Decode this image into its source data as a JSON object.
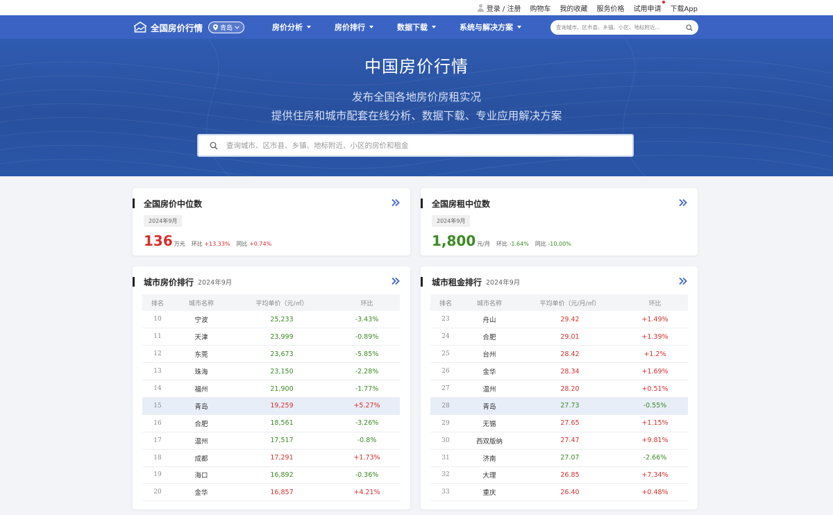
{
  "topbar": {
    "login": "登录 / 注册",
    "cart": "购物车",
    "favorites": "我的收藏",
    "service_price": "服务价格",
    "trial": "试用申请",
    "download_app": "下载App"
  },
  "nav": {
    "logo_text": "全国房价行情",
    "city": "青岛",
    "menu": [
      "房价分析",
      "房价排行",
      "数据下载",
      "系统与解决方案"
    ],
    "search_placeholder": "查询城市、区市县、乡镇、小区、地标附近..."
  },
  "hero": {
    "title": "中国房价行情",
    "subtitle1": "发布全国各地房价房租实况",
    "subtitle2": "提供住房和城市配套在线分析、数据下载、专业应用解决方案",
    "search_placeholder": "查询城市、区市县、乡镇、地标附近、小区的房价和租金"
  },
  "price_median": {
    "title": "全国房价中位数",
    "date": "2024年9月",
    "value": "136",
    "unit": "万元",
    "mom_label": "环比",
    "mom": "+13.33%",
    "yoy_label": "同比",
    "yoy": "+0.74%"
  },
  "rent_median": {
    "title": "全国房租中位数",
    "date": "2024年9月",
    "value": "1,800",
    "unit": "元/月",
    "mom_label": "环比",
    "mom": "-1.64%",
    "yoy_label": "同比",
    "yoy": "-10.00%"
  },
  "price_rank": {
    "title": "城市房价排行",
    "date": "2024年9月",
    "headers": [
      "排名",
      "城市名称",
      "平均单价（元/㎡）",
      "环比"
    ],
    "rows": [
      {
        "rank": "10",
        "city": "宁波",
        "price": "25,233",
        "chg": "-3.43%",
        "dir": "down"
      },
      {
        "rank": "11",
        "city": "天津",
        "price": "23,999",
        "chg": "-0.89%",
        "dir": "down"
      },
      {
        "rank": "12",
        "city": "东莞",
        "price": "23,673",
        "chg": "-5.85%",
        "dir": "down"
      },
      {
        "rank": "13",
        "city": "珠海",
        "price": "23,150",
        "chg": "-2.28%",
        "dir": "down"
      },
      {
        "rank": "14",
        "city": "福州",
        "price": "21,900",
        "chg": "-1.77%",
        "dir": "down"
      },
      {
        "rank": "15",
        "city": "青岛",
        "price": "19,259",
        "chg": "+5.27%",
        "dir": "up",
        "highlight": true
      },
      {
        "rank": "16",
        "city": "合肥",
        "price": "18,561",
        "chg": "-3.26%",
        "dir": "down"
      },
      {
        "rank": "17",
        "city": "温州",
        "price": "17,517",
        "chg": "-0.8%",
        "dir": "down"
      },
      {
        "rank": "18",
        "city": "成都",
        "price": "17,291",
        "chg": "+1.73%",
        "dir": "up"
      },
      {
        "rank": "19",
        "city": "海口",
        "price": "16,892",
        "chg": "-0.36%",
        "dir": "down"
      },
      {
        "rank": "20",
        "city": "金华",
        "price": "16,857",
        "chg": "+4.21%",
        "dir": "up"
      }
    ]
  },
  "rent_rank": {
    "title": "城市租金排行",
    "date": "2024年9月",
    "headers": [
      "排名",
      "城市名称",
      "平均单价（元/月/㎡）",
      "环比"
    ],
    "rows": [
      {
        "rank": "23",
        "city": "舟山",
        "price": "29.42",
        "chg": "+1.49%",
        "dir": "up"
      },
      {
        "rank": "24",
        "city": "合肥",
        "price": "29.01",
        "chg": "+1.39%",
        "dir": "up"
      },
      {
        "rank": "25",
        "city": "台州",
        "price": "28.42",
        "chg": "+1.2%",
        "dir": "up"
      },
      {
        "rank": "26",
        "city": "金华",
        "price": "28.34",
        "chg": "+1.69%",
        "dir": "up"
      },
      {
        "rank": "27",
        "city": "温州",
        "price": "28.20",
        "chg": "+0.51%",
        "dir": "up"
      },
      {
        "rank": "28",
        "city": "青岛",
        "price": "27.73",
        "chg": "-0.55%",
        "dir": "down",
        "highlight": true
      },
      {
        "rank": "29",
        "city": "无锡",
        "price": "27.65",
        "chg": "+1.15%",
        "dir": "up"
      },
      {
        "rank": "30",
        "city": "西双版纳",
        "price": "27.47",
        "chg": "+9.81%",
        "dir": "up"
      },
      {
        "rank": "31",
        "city": "济南",
        "price": "27.07",
        "chg": "-2.66%",
        "dir": "down"
      },
      {
        "rank": "32",
        "city": "大理",
        "price": "26.85",
        "chg": "+7.34%",
        "dir": "up"
      },
      {
        "rank": "33",
        "city": "重庆",
        "price": "26.40",
        "chg": "+0.48%",
        "dir": "up"
      }
    ]
  },
  "colors": {
    "nav_blue": "#3a63c4",
    "hero_blue": "#2a56a8",
    "up_red": "#d4302b",
    "down_green": "#3b8a23",
    "more_arrow": "#3a63c4"
  }
}
